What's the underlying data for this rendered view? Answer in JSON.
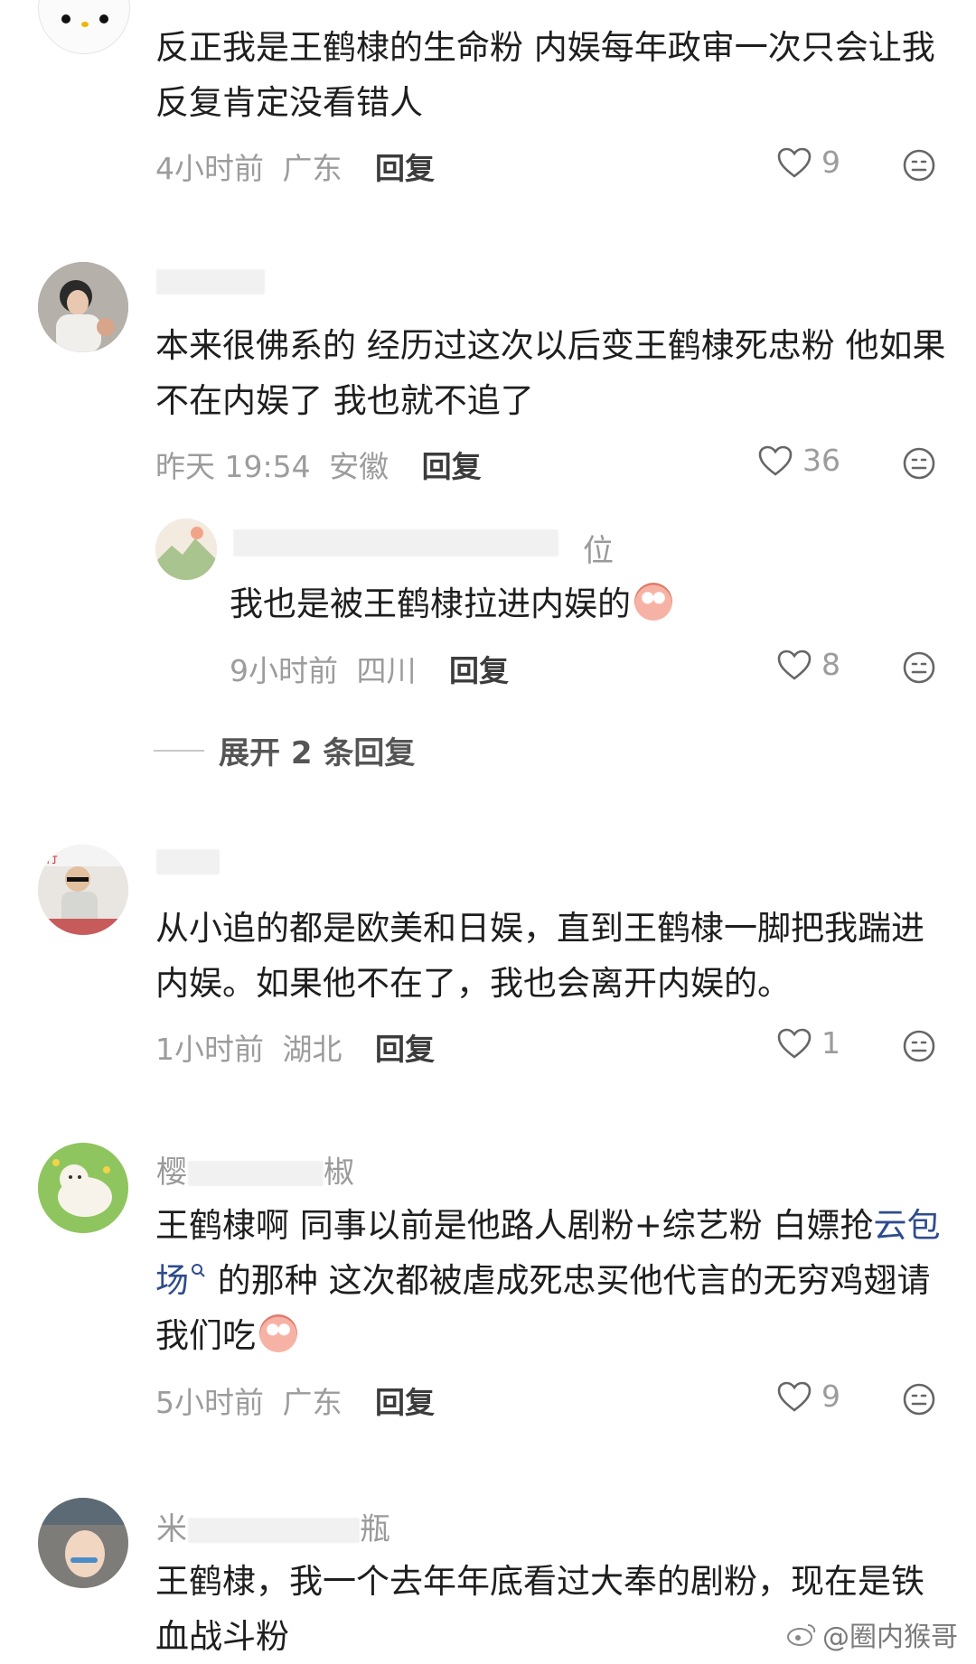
{
  "comments": [
    {
      "name": "",
      "text": "反正我是王鹤棣的生命粉 内娱每年政审一次只会让我反复肯定没看错人",
      "time": "4小时前",
      "location": "广东",
      "reply": "回复",
      "likes": "9"
    },
    {
      "name": "",
      "text": "本来很佛系的 经历过这次以后变王鹤棣死忠粉 他如果不在内娱了 我也就不追了",
      "time": "昨天 19:54",
      "location": "安徽",
      "reply": "回复",
      "likes": "36",
      "sub_reply": {
        "name_fragment": "位",
        "text": "我也是被王鹤棣拉进内娱的",
        "time": "9小时前",
        "location": "四川",
        "reply": "回复",
        "likes": "8"
      },
      "expand_label": "展开 2 条回复"
    },
    {
      "name": "",
      "text": "从小追的都是欧美和日娱，直到王鹤棣一脚把我踹进内娱。如果他不在了，我也会离开内娱的。",
      "time": "1小时前",
      "location": "湖北",
      "reply": "回复",
      "likes": "1"
    },
    {
      "name": "樱",
      "name_tail": "椒",
      "text_a": "王鹤棣啊 同事以前是他路人剧粉+综艺粉 白嫖抢",
      "link": "云包场",
      "text_b": " 的那种 这次都被虐成死忠买他代言的无穷鸡翅请我们吃",
      "time": "5小时前",
      "location": "广东",
      "reply": "回复",
      "likes": "9"
    },
    {
      "name": "米",
      "name_tail": "瓶",
      "text": "王鹤棣，我一个去年年底看过大奉的剧粉，现在是铁血战斗粉"
    }
  ],
  "watermark": "@圈内猴哥",
  "colors": {
    "meta": "#9c9c9c",
    "link": "#2f4c8c",
    "text": "#1e1e1e"
  }
}
